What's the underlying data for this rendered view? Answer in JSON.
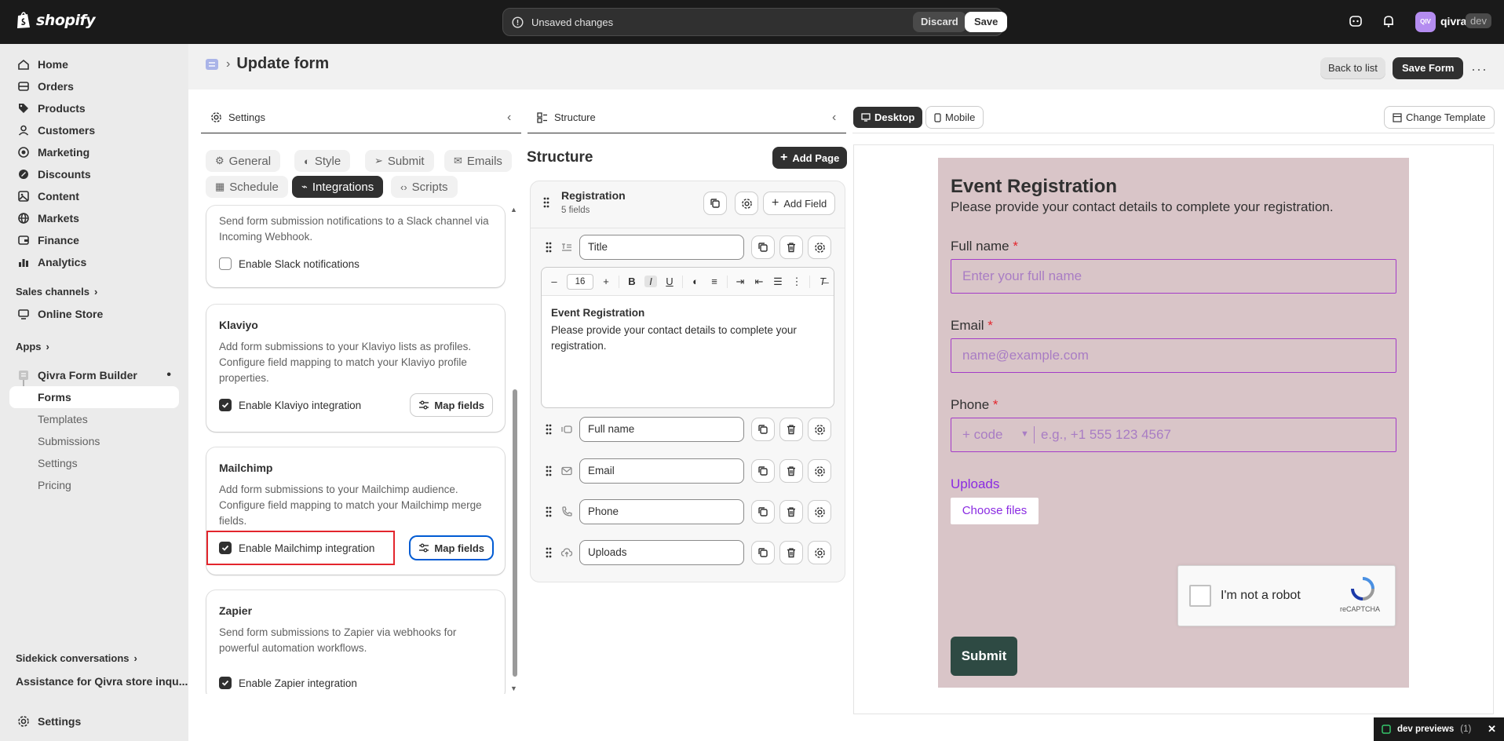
{
  "topbar": {
    "brand": "shopify",
    "unsaved_text": "Unsaved changes",
    "discard_label": "Discard",
    "save_label": "Save",
    "store_initials": "QIV",
    "store_name": "qivra",
    "store_tag": "dev"
  },
  "sidebar": {
    "items": [
      {
        "label": "Home",
        "icon": "home-icon"
      },
      {
        "label": "Orders",
        "icon": "orders-icon"
      },
      {
        "label": "Products",
        "icon": "tag-icon"
      },
      {
        "label": "Customers",
        "icon": "person-icon"
      },
      {
        "label": "Marketing",
        "icon": "target-icon"
      },
      {
        "label": "Discounts",
        "icon": "discount-icon"
      },
      {
        "label": "Content",
        "icon": "content-icon"
      },
      {
        "label": "Markets",
        "icon": "globe-icon"
      },
      {
        "label": "Finance",
        "icon": "finance-icon"
      },
      {
        "label": "Analytics",
        "icon": "bar-chart-icon"
      }
    ],
    "sales_channels_label": "Sales channels",
    "online_store": "Online Store",
    "apps_label": "Apps",
    "app_name": "Qivra Form Builder",
    "app_subitems": [
      "Forms",
      "Templates",
      "Submissions",
      "Settings",
      "Pricing"
    ],
    "sidekick_label": "Sidekick conversations",
    "sidekick_item": "Assistance for Qivra store inqu...",
    "settings_label": "Settings"
  },
  "header": {
    "title": "Update form",
    "back_to_list": "Back to list",
    "save_form": "Save Form",
    "more": "···"
  },
  "settings_panel": {
    "title": "Settings",
    "tabs": [
      "General",
      "Style",
      "Submit",
      "Emails",
      "Schedule",
      "Integrations",
      "Scripts"
    ],
    "active_tab": "Integrations",
    "slack": {
      "desc": "Send form submission notifications to a Slack channel via Incoming Webhook.",
      "checkbox": "Enable Slack notifications",
      "checked": false
    },
    "klaviyo": {
      "title": "Klaviyo",
      "desc": "Add form submissions to your Klaviyo lists as profiles. Configure field mapping to match your Klaviyo profile properties.",
      "checkbox": "Enable Klaviyo integration",
      "checked": true,
      "map_fields": "Map fields"
    },
    "mailchimp": {
      "title": "Mailchimp",
      "desc": "Add form submissions to your Mailchimp audience. Configure field mapping to match your Mailchimp merge fields.",
      "checkbox": "Enable Mailchimp integration",
      "checked": true,
      "map_fields": "Map fields"
    },
    "zapier": {
      "title": "Zapier",
      "desc": "Send form submissions to Zapier via webhooks for powerful automation workflows.",
      "checkbox": "Enable Zapier integration",
      "checked": true
    }
  },
  "structure_panel": {
    "title": "Structure",
    "heading": "Structure",
    "add_page": "Add Page",
    "page_name": "Registration",
    "page_count": "5 fields",
    "add_field": "Add Field",
    "fields": [
      {
        "label": "Title",
        "icon": "text-icon"
      },
      {
        "label": "Full name",
        "icon": "name-icon"
      },
      {
        "label": "Email",
        "icon": "mail-icon"
      },
      {
        "label": "Phone",
        "icon": "phone-icon"
      },
      {
        "label": "Uploads",
        "icon": "upload-icon"
      }
    ],
    "editor": {
      "font_size": "16",
      "heading": "Event Registration",
      "body": "Please provide your contact details to complete your registration."
    }
  },
  "preview": {
    "desktop_label": "Desktop",
    "mobile_label": "Mobile",
    "change_template": "Change Template",
    "form": {
      "title": "Event Registration",
      "subtitle": "Please provide your contact details to complete your registration.",
      "full_name_label": "Full name",
      "full_name_placeholder": "Enter your full name",
      "email_label": "Email",
      "email_placeholder": "name@example.com",
      "phone_label": "Phone",
      "phone_code": "+ code",
      "phone_placeholder": "e.g., +1 555 123 4567",
      "required_mark": "*",
      "uploads_label": "Uploads",
      "choose_files": "Choose files",
      "recaptcha_text": "I'm not a robot",
      "recaptcha_brand": "reCAPTCHA",
      "submit": "Submit"
    },
    "canvas_color": "#d9c5c8",
    "accent_color": "#a43cc8",
    "submit_color": "#2e4a43"
  },
  "dev_bar": {
    "label": "dev previews",
    "count": "(1)"
  }
}
